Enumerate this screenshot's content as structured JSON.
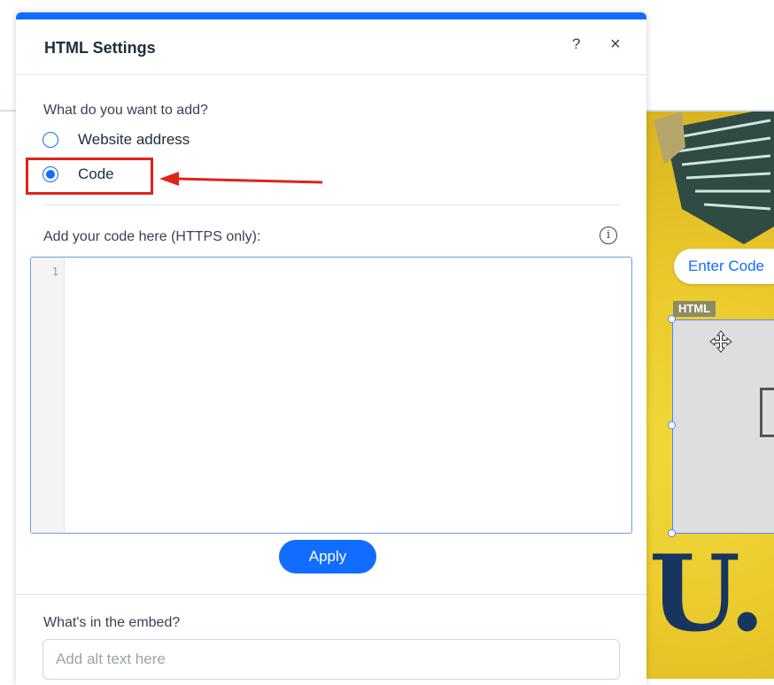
{
  "panel": {
    "title": "HTML Settings",
    "help_label": "?",
    "close_label": "×",
    "add_question": "What do you want to add?",
    "options": [
      {
        "label": "Website address",
        "selected": false
      },
      {
        "label": "Code",
        "selected": true
      }
    ],
    "code_label": "Add your code here (HTTPS only):",
    "info_label": "i",
    "editor_line_number": "1",
    "apply_label": "Apply",
    "embed_question": "What's in the embed?",
    "alt_placeholder": "Add alt text here"
  },
  "canvas": {
    "enter_code_label": "Enter Code",
    "element_tag": "HTML",
    "heading_fragment": "U."
  },
  "colors": {
    "accent": "#116dff",
    "annotation": "#e0231b",
    "site_background": "#e9c72a",
    "heading": "#17365f"
  },
  "icons": [
    "help-icon",
    "close-icon",
    "info-icon",
    "move-cursor-icon",
    "embed-icon",
    "arrow-annotation"
  ]
}
